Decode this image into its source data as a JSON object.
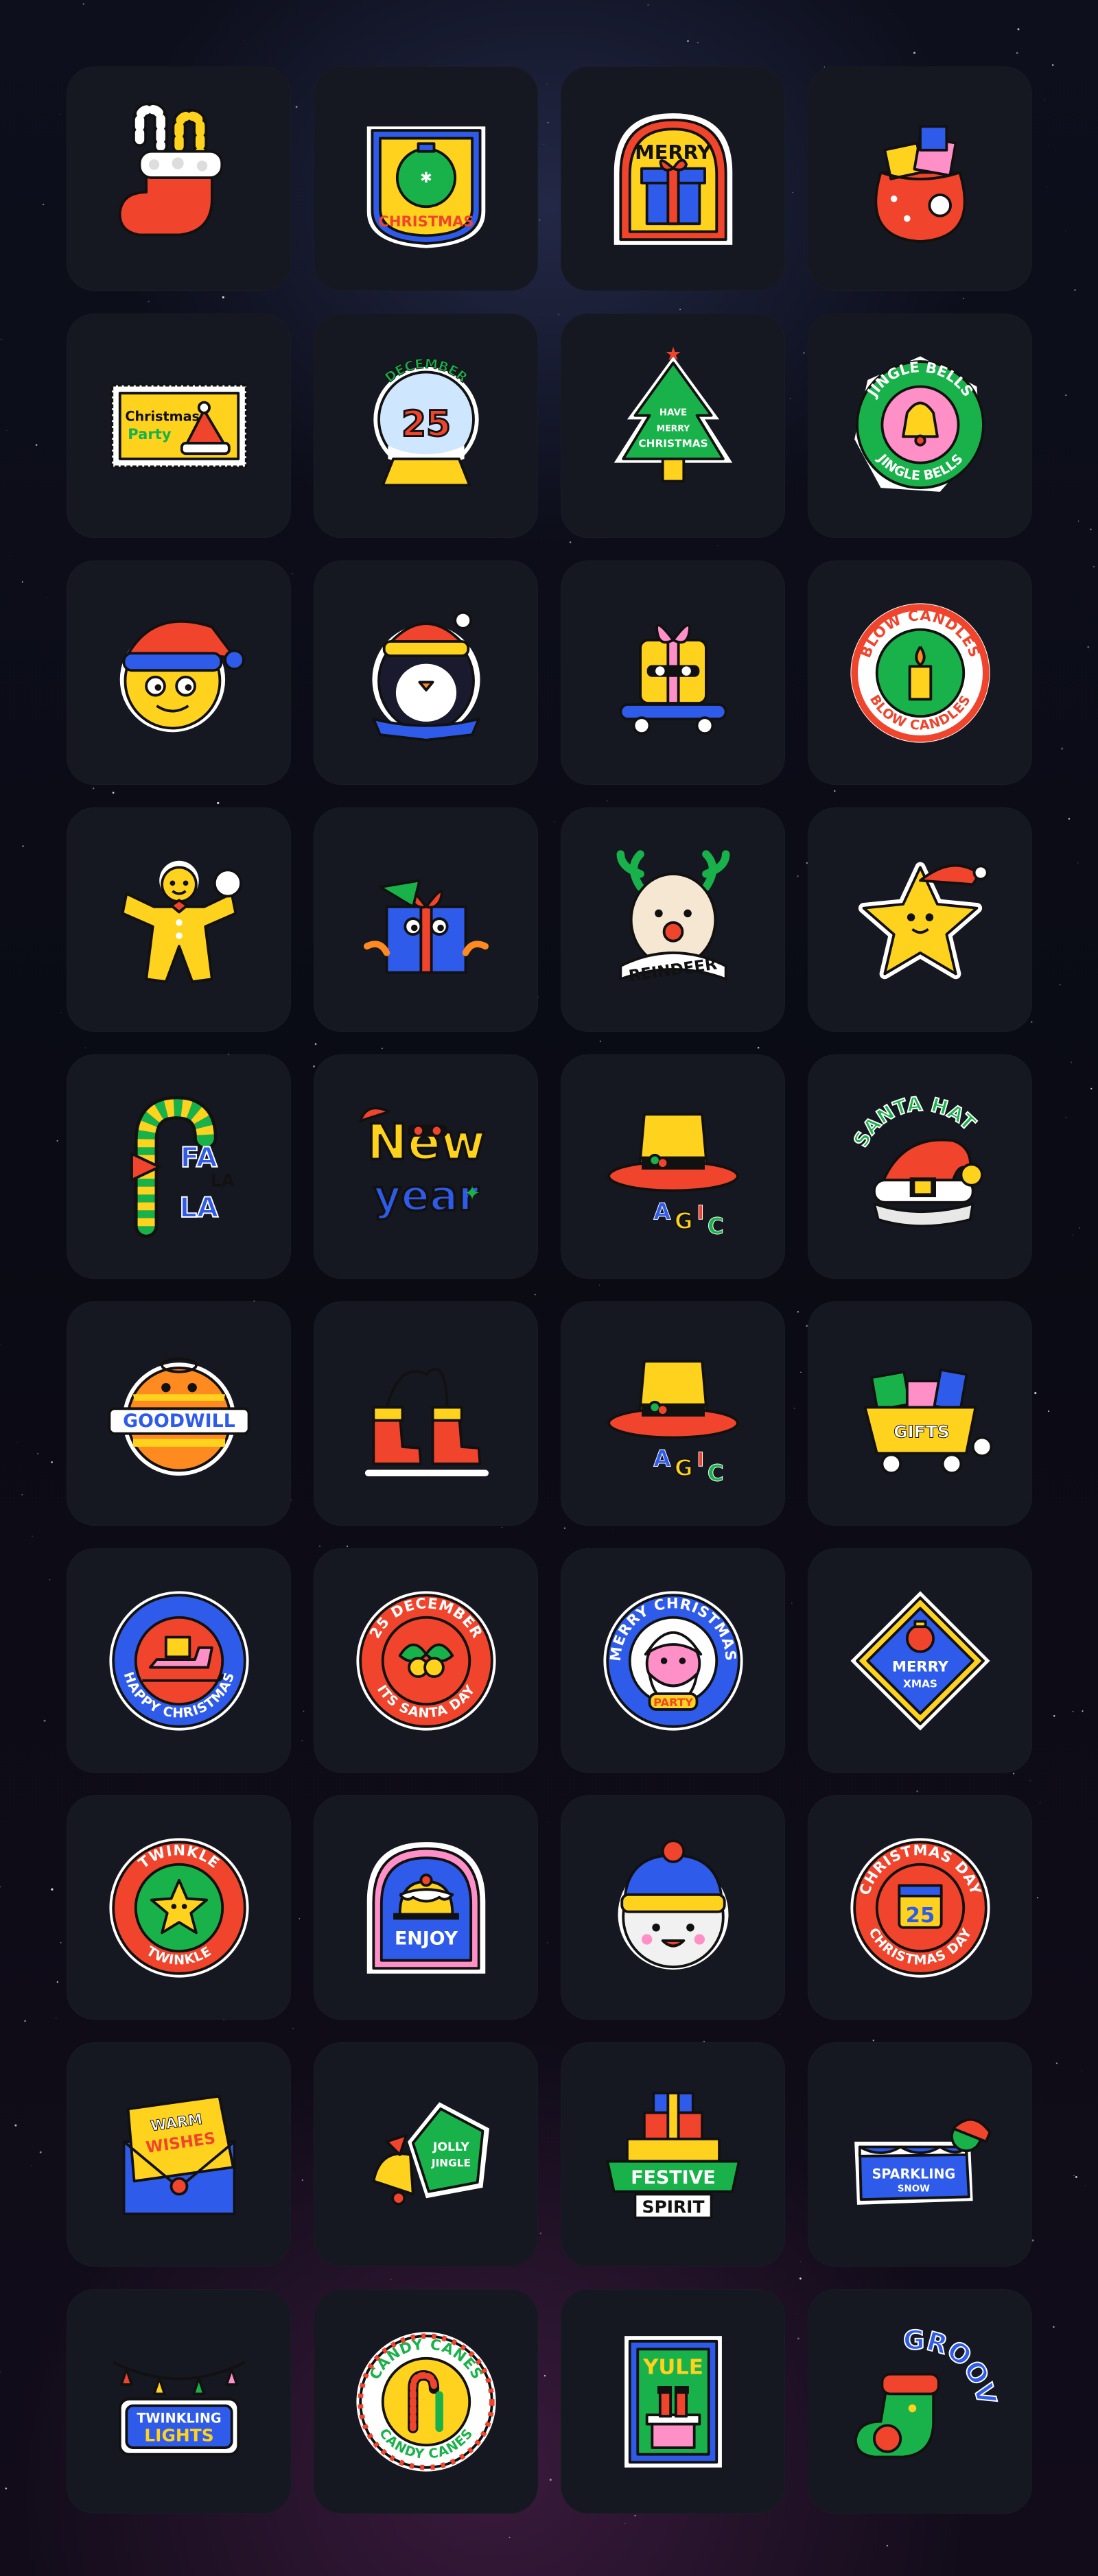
{
  "stickers": [
    {
      "label": "",
      "icon": "candy-stocking-icon",
      "kind": "stocking"
    },
    {
      "label": "CHRISTMAS",
      "icon": "ornament-badge-icon",
      "kind": "ornament"
    },
    {
      "label": "MERRY",
      "icon": "gift-arch-icon",
      "kind": "arch-gift"
    },
    {
      "label": "",
      "icon": "santa-sack-icon",
      "kind": "sack"
    },
    {
      "label": "Christmas Party",
      "icon": "party-stamp-icon",
      "kind": "stamp"
    },
    {
      "label": "DECEMBER 25",
      "icon": "snow-globe-icon",
      "kind": "globe"
    },
    {
      "label": "HAVE A MERRY CHRISTMAS",
      "icon": "christmas-tree-icon",
      "kind": "tree"
    },
    {
      "label": "JINGLE BELLS",
      "icon": "jingle-bells-icon",
      "kind": "jingle"
    },
    {
      "label": "",
      "icon": "smiley-santa-hat-icon",
      "kind": "smiley"
    },
    {
      "label": "",
      "icon": "penguin-icon",
      "kind": "penguin"
    },
    {
      "label": "",
      "icon": "gift-skateboard-icon",
      "kind": "skate"
    },
    {
      "label": "BLOW CANDLES",
      "icon": "candle-badge-icon",
      "kind": "candle"
    },
    {
      "label": "",
      "icon": "gingerbread-icon",
      "kind": "ginger"
    },
    {
      "label": "",
      "icon": "gift-character-icon",
      "kind": "giftchar"
    },
    {
      "label": "REINDEER",
      "icon": "reindeer-icon",
      "kind": "reindeer"
    },
    {
      "label": "",
      "icon": "star-santa-hat-icon",
      "kind": "star"
    },
    {
      "label": "FA LA LA",
      "icon": "candy-cane-icon",
      "kind": "falala"
    },
    {
      "label": "New year",
      "icon": "new-year-icon",
      "kind": "newyear"
    },
    {
      "label": "AGIC",
      "icon": "magic-hat-icon",
      "kind": "magic"
    },
    {
      "label": "SANTA HAT",
      "icon": "santa-hat-icon",
      "kind": "santahat"
    },
    {
      "label": "GOODWILL",
      "icon": "goodwill-ornament-icon",
      "kind": "goodwill"
    },
    {
      "label": "",
      "icon": "ice-skates-icon",
      "kind": "skates"
    },
    {
      "label": "AGIC",
      "icon": "magic-hat-icon",
      "kind": "magic"
    },
    {
      "label": "GIFTS",
      "icon": "gift-cart-icon",
      "kind": "cart"
    },
    {
      "label": "HAPPY CHRISTMAS",
      "icon": "sleigh-badge-icon",
      "kind": "sleigh"
    },
    {
      "label": "25 DECEMBER · ITS SANTA DAY",
      "icon": "holly-badge-icon",
      "kind": "holly"
    },
    {
      "label": "MERRY CHRISTMAS · PARTY",
      "icon": "santa-face-badge-icon",
      "kind": "santaface"
    },
    {
      "label": "MERRY XMAS",
      "icon": "ornament-diamond-icon",
      "kind": "diamond"
    },
    {
      "label": "TWINKLE TWINKLE",
      "icon": "twinkle-star-badge-icon",
      "kind": "twinkle"
    },
    {
      "label": "ENJOY",
      "icon": "pudding-arch-icon",
      "kind": "enjoy"
    },
    {
      "label": "",
      "icon": "beanie-character-icon",
      "kind": "beanie"
    },
    {
      "label": "CHRISTMAS DAY · 25",
      "icon": "calendar-badge-icon",
      "kind": "calendar"
    },
    {
      "label": "WARM WISHES",
      "icon": "envelope-icon",
      "kind": "envelope"
    },
    {
      "label": "JOLLY JINGLE",
      "icon": "bell-pentagon-icon",
      "kind": "bellpent"
    },
    {
      "label": "FESTIVE SPIRIT",
      "icon": "gift-stack-icon",
      "kind": "festive"
    },
    {
      "label": "SPARKLING SNOW",
      "icon": "snow-banner-icon",
      "kind": "snowbanner"
    },
    {
      "label": "TWINKLING LIGHTS",
      "icon": "lights-banner-icon",
      "kind": "lights"
    },
    {
      "label": "CANDY CANES",
      "icon": "candy-cane-badge-icon",
      "kind": "candybadge"
    },
    {
      "label": "YULE",
      "icon": "chimney-santa-icon",
      "kind": "yule"
    },
    {
      "label": "GROOVY",
      "icon": "groovy-stocking-icon",
      "kind": "groovy"
    }
  ],
  "colors": {
    "red": "#f0442c",
    "yellow": "#ffd21e",
    "blue": "#2f5bea",
    "green": "#19b24a",
    "pink": "#ff8fc7",
    "orange": "#ff8a1f",
    "cream": "#fff4d6",
    "outline": "#111111",
    "tile": "#161821"
  }
}
